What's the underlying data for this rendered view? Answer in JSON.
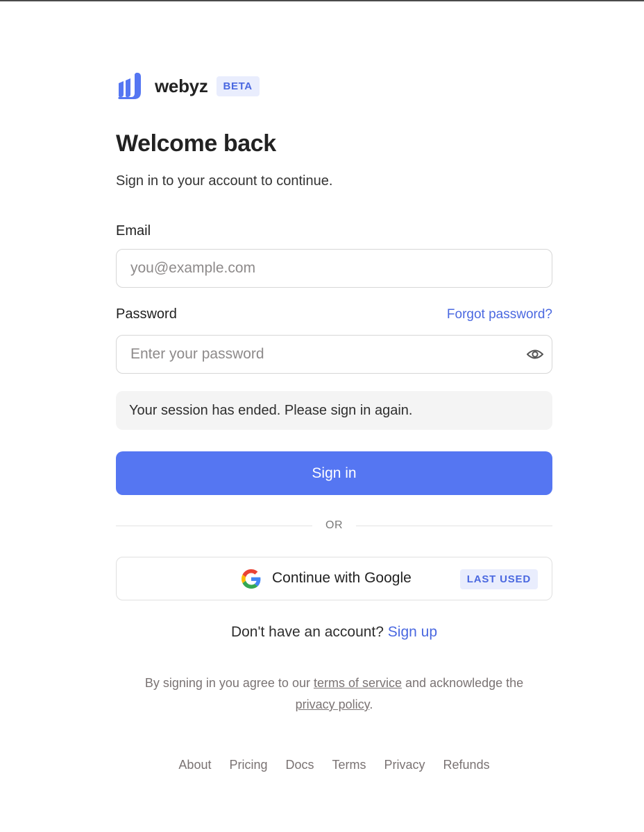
{
  "brand": {
    "name": "webyz",
    "badge": "BETA",
    "logo_icon": "webyz-logo-icon",
    "accent_color": "#5576f2"
  },
  "header": {
    "title": "Welcome back",
    "subtitle": "Sign in to your account to continue."
  },
  "form": {
    "email": {
      "label": "Email",
      "placeholder": "you@example.com",
      "value": ""
    },
    "password": {
      "label": "Password",
      "placeholder": "Enter your password",
      "value": "",
      "forgot_link": "Forgot password?",
      "toggle_icon": "eye-icon"
    },
    "notice": "Your session has ended. Please sign in again.",
    "submit_label": "Sign in"
  },
  "divider": {
    "label": "OR"
  },
  "oauth": {
    "google": {
      "icon": "google-icon",
      "label": "Continue with Google",
      "badge": "LAST USED"
    }
  },
  "signup": {
    "prompt": "Don't have an account?",
    "link": "Sign up"
  },
  "legal": {
    "prefix": "By signing in you agree to our",
    "terms_link": "terms of service",
    "middle": "and acknowledge the",
    "privacy_link": "privacy policy",
    "suffix": "."
  },
  "footer": {
    "links": [
      "About",
      "Pricing",
      "Docs",
      "Terms",
      "Privacy",
      "Refunds"
    ]
  }
}
